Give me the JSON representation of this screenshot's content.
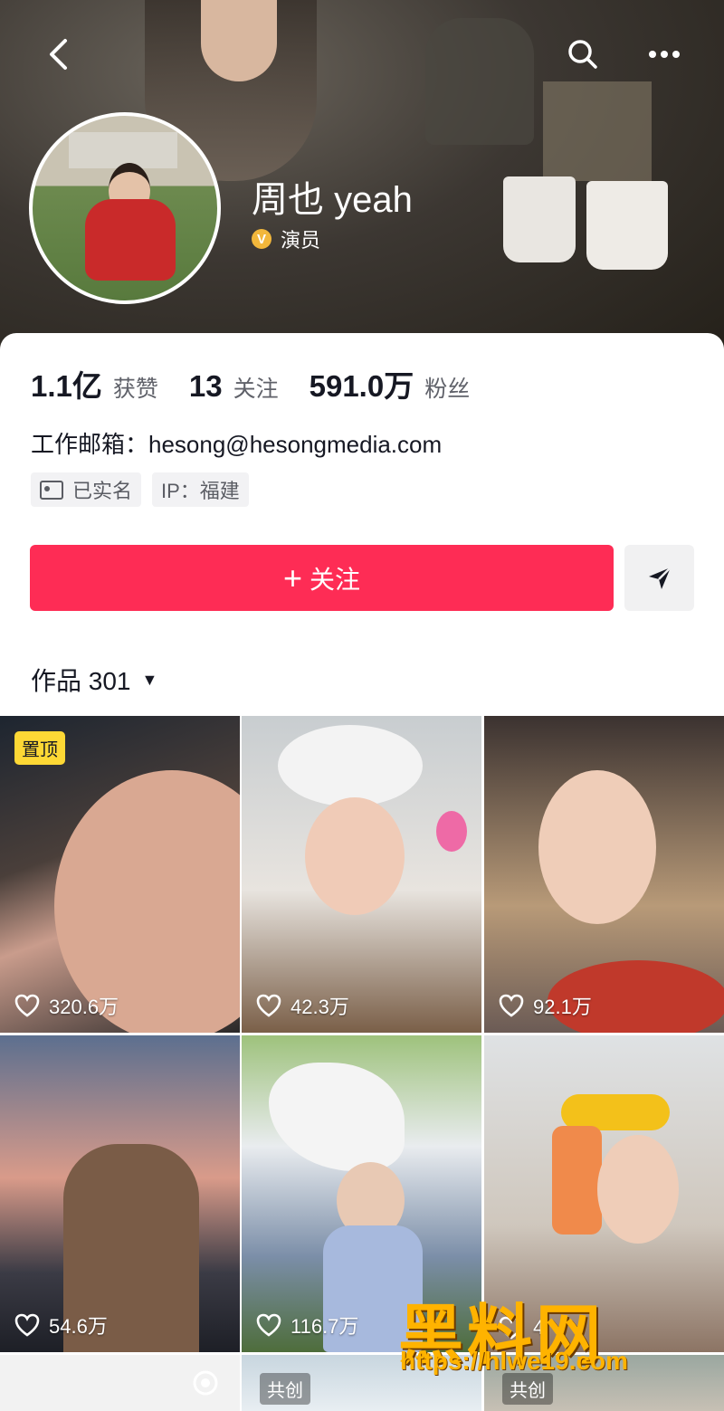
{
  "profile": {
    "name": "周也 yeah",
    "badge": "演员",
    "badge_mark": "V",
    "likes_num": "1.1亿",
    "likes_label": "获赞",
    "following_num": "13",
    "following_label": "关注",
    "followers_num": "591.0万",
    "followers_label": "粉丝",
    "email": "工作邮箱：hesong@hesongmedia.com",
    "tag_verified": "已实名",
    "tag_ip": "IP：福建"
  },
  "actions": {
    "follow_plus": "+",
    "follow_label": "关注"
  },
  "works": {
    "label": "作品 301",
    "caret": "▼"
  },
  "videos": [
    {
      "likes": "320.6万",
      "pinned": "置顶"
    },
    {
      "likes": "42.3万"
    },
    {
      "likes": "92.1万"
    },
    {
      "likes": "54.6万"
    },
    {
      "likes": "116.7万"
    },
    {
      "likes": "4"
    },
    {
      "cocreate": ""
    },
    {
      "cocreate": "共创"
    },
    {
      "cocreate": "共创"
    }
  ],
  "watermark": {
    "logo": "黑料网",
    "url": "https://hlwe19.com"
  },
  "icons": [
    "back-icon",
    "search-icon",
    "more-icon",
    "share-icon",
    "heart-icon",
    "id-card-icon",
    "camera-icon"
  ],
  "colors": {
    "accent": "#fe2c55",
    "pin": "#fdd835",
    "verified": "#f2b73b"
  }
}
